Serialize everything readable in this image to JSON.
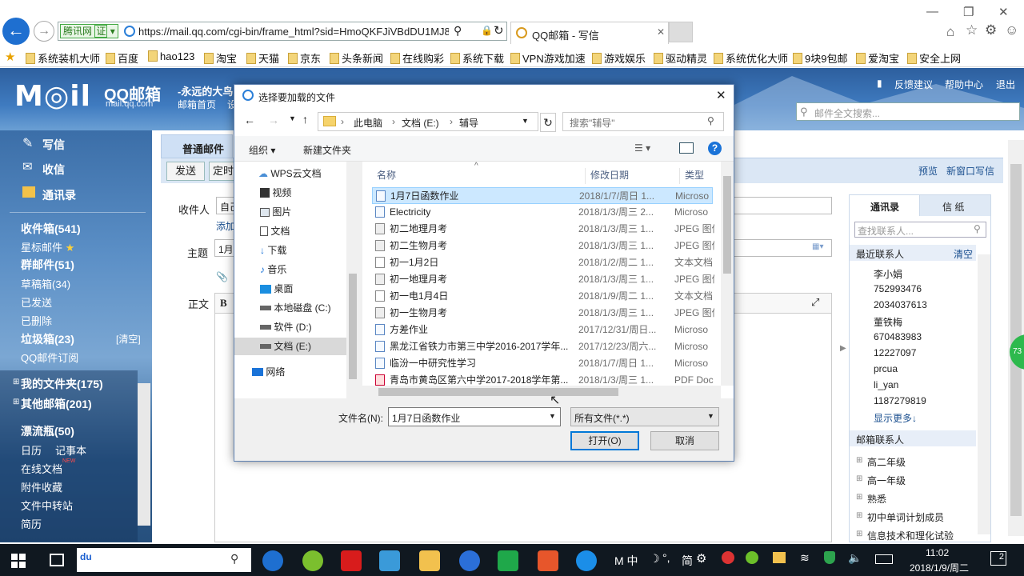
{
  "browser": {
    "address_tag": "腾讯网",
    "address_tag2": "证",
    "url": "https://mail.qq.com/cgi-bin/frame_html?sid=HmoQKFJiVBdDU1MJ8",
    "tab_title": "QQ邮箱 - 写信",
    "favorites": [
      "系统装机大师",
      "百度",
      "hao123",
      "淘宝",
      "天猫",
      "京东",
      "头条新闻",
      "在线购彩",
      "系统下载",
      "VPN游戏加速",
      "游戏娱乐",
      "驱动精灵",
      "系统优化大师",
      "9块9包邮",
      "爱淘宝",
      "安全上网"
    ]
  },
  "qqmail": {
    "logo_text": "M◎il",
    "logo_cn": "QQ邮箱",
    "logo_domain": "mail.qq.com",
    "header_user": "-永远的大鸟",
    "header_home": "邮箱首页",
    "header_setting": "设",
    "feedback": "反馈建议",
    "help": "帮助中心",
    "logout": "退出",
    "search_placeholder": "邮件全文搜索...",
    "nav": {
      "write": "写信",
      "inbox": "收信",
      "contacts": "通讯录"
    },
    "folders": {
      "inbox": "收件箱(541)",
      "starred": "星标邮件",
      "group": "群邮件(51)",
      "drafts": "草稿箱(34)",
      "sent": "已发送",
      "deleted": "已删除",
      "junk": "垃圾箱(23)",
      "junk_clear": "[清空]",
      "subscribe": "QQ邮件订阅",
      "my_folders": "我的文件夹(175)",
      "other": "其他邮箱(201)",
      "drift": "漂流瓶(50)",
      "calendar": "日历",
      "notes": "记事本",
      "online_docs": "在线文档",
      "new_badge": "NEW",
      "attachments": "附件收藏",
      "transfer": "文件中转站",
      "resume": "简历"
    },
    "compose": {
      "tab": "普通邮件",
      "send": "发送",
      "schedule": "定时",
      "preview": "预览",
      "new_window": "新窗口写信",
      "recipient_label": "收件人",
      "recipient_value": "自己",
      "add_cc": "添加",
      "subject_label": "主题",
      "subject_value": "1月",
      "body_label": "正文",
      "bold": "B"
    },
    "contacts_panel": {
      "tab1": "通讯录",
      "tab2": "信 纸",
      "search_placeholder": "查找联系人...",
      "recent": "最近联系人",
      "clear": "清空",
      "list": [
        "李小娟",
        "752993476",
        "2034037613",
        "董铁梅",
        "670483983",
        "12227097",
        "prcua",
        "li_yan",
        "1187279819"
      ],
      "more": "显示更多↓",
      "mail_contacts": "邮箱联系人",
      "groups": [
        "高二年级",
        "高一年级",
        "熟悉",
        "初中单词计划成员",
        "信息技术和理化试验"
      ]
    }
  },
  "dialog": {
    "title": "选择要加载的文件",
    "path": [
      "此电脑",
      "文档 (E:)",
      "辅导"
    ],
    "search_placeholder": "搜索\"辅导\"",
    "organize": "组织",
    "new_folder": "新建文件夹",
    "tree": [
      {
        "label": "WPS云文档",
        "icon": "cloud-icon"
      },
      {
        "label": "视频",
        "icon": "video-icon"
      },
      {
        "label": "图片",
        "icon": "picture-icon"
      },
      {
        "label": "文档",
        "icon": "document-icon"
      },
      {
        "label": "下载",
        "icon": "download-icon"
      },
      {
        "label": "音乐",
        "icon": "music-icon"
      },
      {
        "label": "桌面",
        "icon": "desktop-icon"
      },
      {
        "label": "本地磁盘 (C:)",
        "icon": "drive-icon"
      },
      {
        "label": "软件 (D:)",
        "icon": "drive-icon"
      },
      {
        "label": "文档 (E:)",
        "icon": "drive-icon"
      },
      {
        "label": "网络",
        "icon": "network-icon"
      }
    ],
    "columns": {
      "name": "名称",
      "date": "修改日期",
      "type": "类型"
    },
    "files": [
      {
        "name": "1月7日函数作业",
        "date": "2018/1/7/周日 1...",
        "type": "Microso",
        "kind": "doc"
      },
      {
        "name": "Electricity",
        "date": "2018/1/3/周三 2...",
        "type": "Microso",
        "kind": "doc"
      },
      {
        "name": "初二地理月考",
        "date": "2018/1/3/周三 1...",
        "type": "JPEG 图像",
        "kind": "img"
      },
      {
        "name": "初二生物月考",
        "date": "2018/1/3/周三 1...",
        "type": "JPEG 图像",
        "kind": "img"
      },
      {
        "name": "初一1月2日",
        "date": "2018/1/2/周二 1...",
        "type": "文本文档",
        "kind": "txt"
      },
      {
        "name": "初一地理月考",
        "date": "2018/1/3/周三 1...",
        "type": "JPEG 图像",
        "kind": "img"
      },
      {
        "name": "初一电1月4日",
        "date": "2018/1/9/周二 1...",
        "type": "文本文档",
        "kind": "txt"
      },
      {
        "name": "初一生物月考",
        "date": "2018/1/3/周三 1...",
        "type": "JPEG 图像",
        "kind": "img"
      },
      {
        "name": "方差作业",
        "date": "2017/12/31/周日...",
        "type": "Microso",
        "kind": "doc"
      },
      {
        "name": "黑龙江省铁力市第三中学2016-2017学年...",
        "date": "2017/12/23/周六...",
        "type": "Microso",
        "kind": "doc"
      },
      {
        "name": "临汾一中研究性学习",
        "date": "2018/1/7/周日 1...",
        "type": "Microso",
        "kind": "doc"
      },
      {
        "name": "青岛市黄岛区第六中学2017-2018学年第...",
        "date": "2018/1/3/周三 1...",
        "type": "PDF Doc",
        "kind": "pdf"
      }
    ],
    "filename_label": "文件名(N):",
    "filename_value": "1月7日函数作业",
    "filter": "所有文件(*.*)",
    "open": "打开(O)",
    "cancel": "取消"
  },
  "taskbar": {
    "ime_mode": "M 中",
    "ime_extra": "简",
    "time": "11:02",
    "date": "2018/1/9/周二",
    "notifications": "2",
    "side_badge": "73"
  }
}
